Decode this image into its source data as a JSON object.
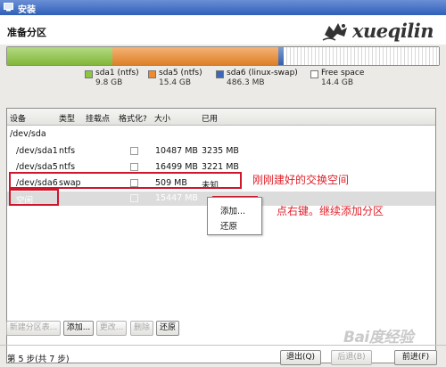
{
  "window": {
    "title": "安装"
  },
  "header": {
    "heading": "准备分区",
    "logo_text": "xueqilin"
  },
  "partitions_bar": [
    {
      "name": "sda1",
      "fs": "ntfs",
      "color": "#8cc63f",
      "size_gb": 9.8
    },
    {
      "name": "sda5",
      "fs": "ntfs",
      "color": "#f08a2b",
      "size_gb": 15.4
    },
    {
      "name": "sda6",
      "fs": "linux-swap",
      "color": "#3b68b8",
      "size_gb": 0.4863
    },
    {
      "name": "free",
      "fs": "",
      "color": "#ffffff",
      "size_gb": 14.4
    }
  ],
  "legend": [
    {
      "label": "sda1 (ntfs)",
      "size": "9.8 GB",
      "color": "#8cc63f"
    },
    {
      "label": "sda5 (ntfs)",
      "size": "15.4 GB",
      "color": "#f08a2b"
    },
    {
      "label": "sda6 (linux-swap)",
      "size": "486.3 MB",
      "color": "#3b68b8"
    },
    {
      "label": "Free space",
      "size": "14.4 GB",
      "color": "#ffffff"
    }
  ],
  "table": {
    "headers": [
      "设备",
      "类型",
      "挂载点",
      "格式化?",
      "大小",
      "已用"
    ],
    "rows": [
      {
        "device": "/dev/sda",
        "type": "",
        "mount": "",
        "size": "",
        "used": ""
      },
      {
        "device": "/dev/sda1",
        "type": "ntfs",
        "mount": "",
        "size": "10487 MB",
        "used": "3235 MB"
      },
      {
        "device": "/dev/sda5",
        "type": "ntfs",
        "mount": "",
        "size": "16499 MB",
        "used": "3221 MB"
      },
      {
        "device": "/dev/sda6",
        "type": "swap",
        "mount": "",
        "size": "509 MB",
        "used": "未知"
      },
      {
        "device": "空闲",
        "type": "",
        "mount": "",
        "size": "15447 MB",
        "used": ""
      }
    ]
  },
  "context_menu": {
    "items": [
      "添加...",
      "还原"
    ]
  },
  "annotations": {
    "swap_note": "刚刚建好的交换空间",
    "right_click_note": "点右键。继续添加分区"
  },
  "buttons": {
    "new_table": "新建分区表...",
    "add": "添加...",
    "change": "更改...",
    "delete": "删除",
    "revert": "还原"
  },
  "footer": {
    "step": "第 5 步(共 7 步)",
    "quit": "退出(Q)",
    "back": "后退(B)",
    "forward": "前进(F)"
  },
  "watermark": "Bai度经验"
}
